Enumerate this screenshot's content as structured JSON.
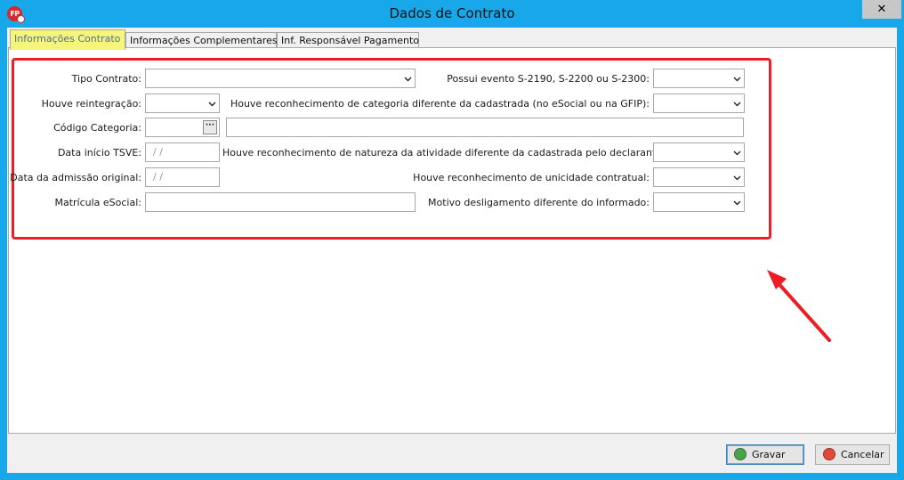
{
  "window": {
    "title": "Dados de Contrato",
    "app_icon_text": "FP",
    "close_glyph": "✕"
  },
  "tabs": [
    {
      "label": "Informações Contrato",
      "active": true
    },
    {
      "label": "Informações Complementares",
      "active": false
    },
    {
      "label": "Inf. Responsável Pagamento",
      "active": false
    }
  ],
  "form": {
    "tipo_contrato": {
      "label": "Tipo Contrato:",
      "value": ""
    },
    "houve_reintegracao": {
      "label": "Houve reintegração:",
      "value": ""
    },
    "codigo_categoria": {
      "label": "Código Categoria:",
      "value": "",
      "description": "",
      "lookup_glyph": "···"
    },
    "data_inicio_tsve": {
      "label": "Data início TSVE:",
      "value": " /  /"
    },
    "data_admissao_original": {
      "label": "Data da admissão original:",
      "value": " /  /"
    },
    "matricula_esocial": {
      "label": "Matrícula eSocial:",
      "value": ""
    },
    "possui_evento": {
      "label": "Possui evento S-2190, S-2200 ou S-2300:",
      "value": ""
    },
    "reconhecimento_categoria": {
      "label": "Houve reconhecimento de categoria diferente da cadastrada (no eSocial ou na GFIP):",
      "value": ""
    },
    "reconhecimento_natureza": {
      "label": "Houve reconhecimento de natureza da atividade diferente da cadastrada pelo declarante:",
      "value": ""
    },
    "reconhecimento_unicidade": {
      "label": "Houve reconhecimento de unicidade contratual:",
      "value": ""
    },
    "motivo_desligamento": {
      "label": "Motivo desligamento diferente do informado:",
      "value": ""
    }
  },
  "buttons": {
    "gravar": {
      "label": "Gravar",
      "icon": "check-icon"
    },
    "cancelar": {
      "label": "Cancelar",
      "icon": "cancel-icon"
    }
  },
  "annotations": {
    "highlight_color": "#ee1c24",
    "arrow_color": "#ee1c24",
    "active_tab_highlight": "#f4f57a"
  }
}
